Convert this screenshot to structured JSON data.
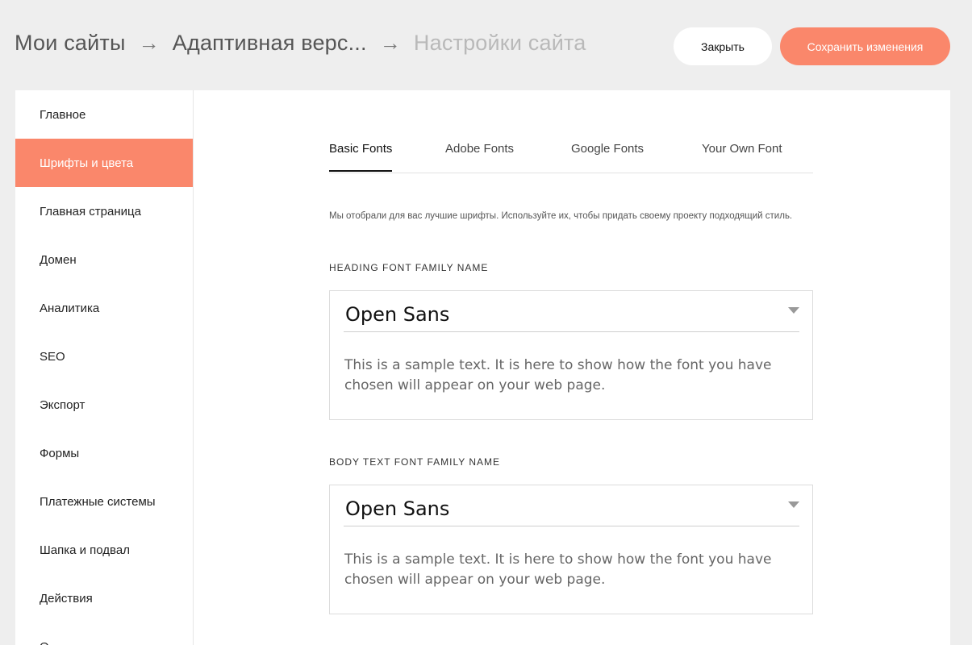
{
  "header": {
    "breadcrumbs": [
      "Мои сайты",
      "Адаптивная верс...",
      "Настройки сайта"
    ],
    "arrow": "→",
    "close_label": "Закрыть",
    "save_label": "Сохранить изменения"
  },
  "sidebar": {
    "items": [
      {
        "label": "Главное"
      },
      {
        "label": "Шрифты и цвета"
      },
      {
        "label": "Главная страница"
      },
      {
        "label": "Домен"
      },
      {
        "label": "Аналитика"
      },
      {
        "label": "SEO"
      },
      {
        "label": "Экспорт"
      },
      {
        "label": "Формы"
      },
      {
        "label": "Платежные системы"
      },
      {
        "label": "Шапка и подвал"
      },
      {
        "label": "Действия"
      },
      {
        "label": "О..."
      }
    ],
    "active_index": 1
  },
  "main": {
    "tabs": [
      {
        "label": "Basic Fonts"
      },
      {
        "label": "Adobe Fonts"
      },
      {
        "label": "Google Fonts"
      },
      {
        "label": "Your Own Font"
      }
    ],
    "description": "Мы отобрали для вас лучшие шрифты. Используйте их, чтобы придать своему проекту подходящий стиль.",
    "heading_font": {
      "label": "HEADING FONT FAMILY NAME",
      "value": "Open Sans",
      "sample": "This is a sample text. It is here to show how the font you have chosen will appear on your web page."
    },
    "body_font": {
      "label": "BODY TEXT FONT FAMILY NAME",
      "value": "Open Sans",
      "sample": "This is a sample text. It is here to show how the font you have chosen will appear on your web page."
    }
  },
  "colors": {
    "accent": "#fa876b",
    "background": "#eeeeee"
  }
}
